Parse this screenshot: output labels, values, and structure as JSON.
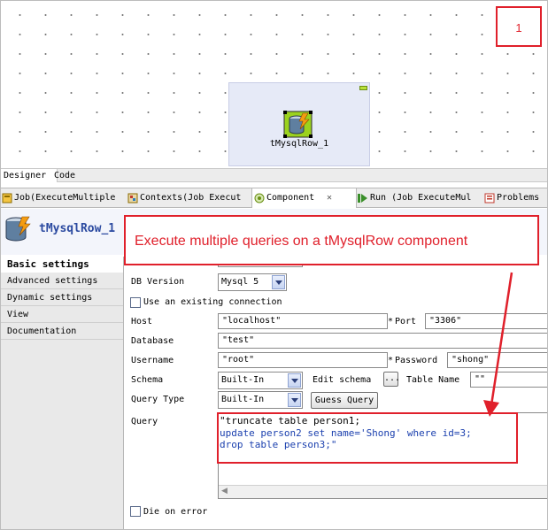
{
  "annotations": {
    "step_number": "1",
    "callout": "Execute multiple queries on a tMysqlRow component"
  },
  "designer": {
    "component_label": "tMysqlRow_1",
    "tabs": [
      "Designer",
      "Code"
    ]
  },
  "view_tabs": [
    {
      "label": "Job(ExecuteMultiple",
      "icon": "job-icon"
    },
    {
      "label": "Contexts(Job Execut",
      "icon": "contexts-icon"
    },
    {
      "label": "Component",
      "icon": "component-icon"
    },
    {
      "label": "Run (Job ExecuteMul",
      "icon": "run-icon"
    },
    {
      "label": "Problems",
      "icon": "problems-icon"
    }
  ],
  "component_title": "tMysqlRow_1",
  "left_panel": [
    "Basic settings",
    "Advanced settings",
    "Dynamic settings",
    "View",
    "Documentation"
  ],
  "form": {
    "db_version_label": "DB Version",
    "db_version_value": "Mysql 5",
    "use_existing_connection": "Use an existing connection",
    "host_label": "Host",
    "host_value": "\"localhost\"",
    "port_label": "Port",
    "port_value": "\"3306\"",
    "database_label": "Database",
    "database_value": "\"test\"",
    "username_label": "Username",
    "username_value": "\"root\"",
    "password_label": "Password",
    "password_value": "\"shong\"",
    "required_mark": "*",
    "schema_label": "Schema",
    "schema_value": "Built-In",
    "edit_schema_label": "Edit schema",
    "edit_schema_button": "...",
    "table_name_label": "Table Name",
    "table_name_value": "\"\"",
    "query_type_label": "Query Type",
    "query_type_value": "Built-In",
    "guess_query_button": "Guess Query",
    "query_label": "Query",
    "query_lines": [
      "\"truncate table person1;",
      "update person2 set name='Shong' where id=3;",
      "drop table person3;\""
    ],
    "die_on_error": "Die on error"
  },
  "colors": {
    "annotation_red": "#e0202b",
    "keyword_blue": "#1a3fae"
  }
}
